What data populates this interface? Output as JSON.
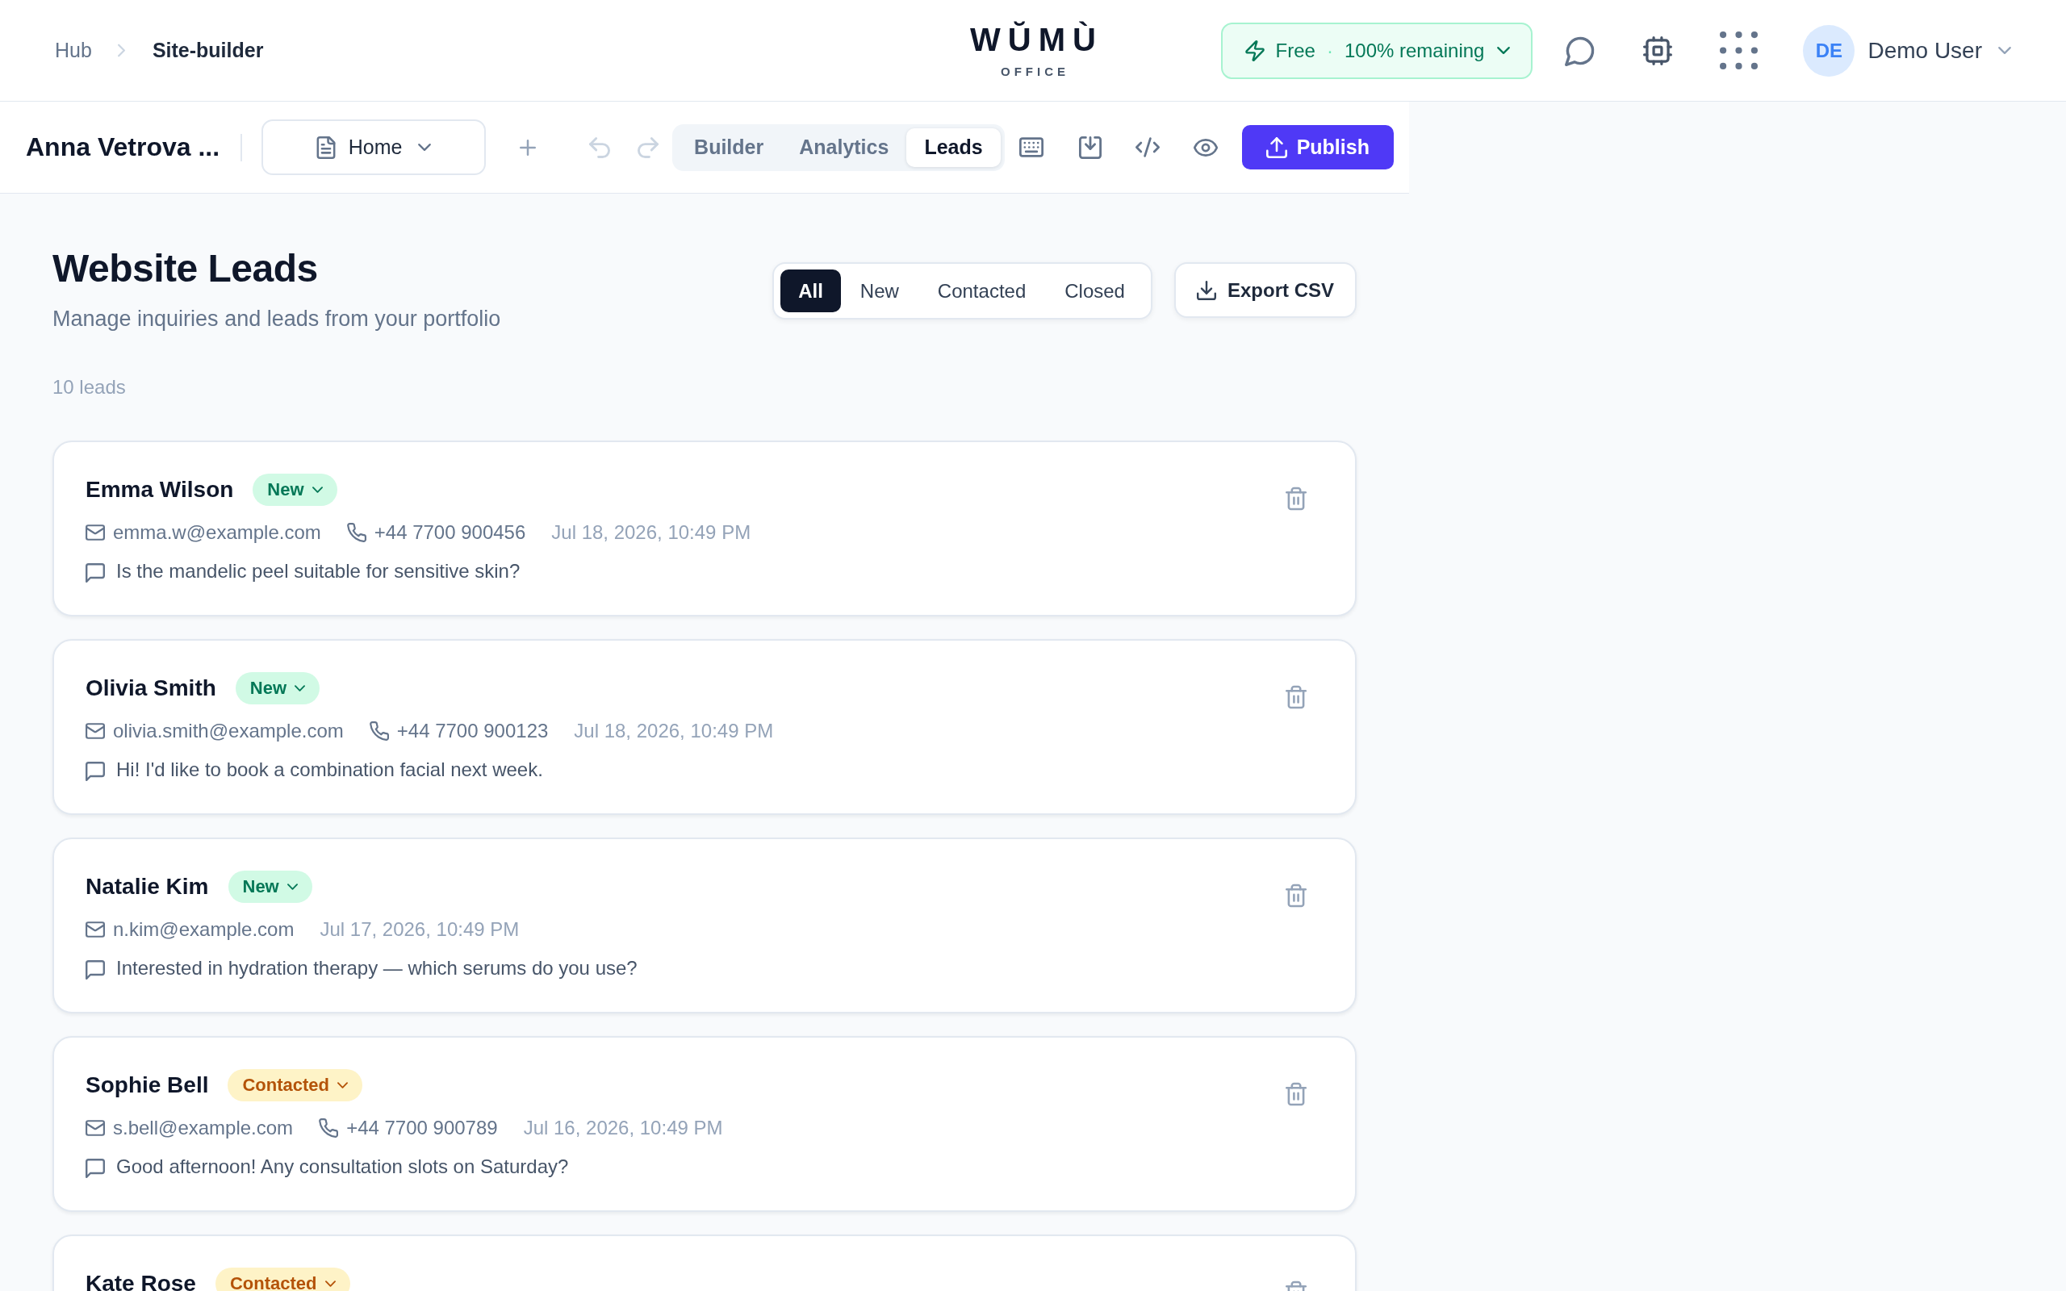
{
  "header": {
    "breadcrumb": [
      {
        "label": "Hub",
        "current": false
      },
      {
        "label": "Site-builder",
        "current": true
      }
    ],
    "logo": {
      "wordmark": "WŬMÙ",
      "tagline": "OFFICE"
    },
    "plan": {
      "name": "Free",
      "separator": "·",
      "quota": "100% remaining"
    },
    "user": {
      "initials": "DE",
      "name": "Demo User"
    }
  },
  "toolbar": {
    "site_name": "Anna Vetrova ...",
    "page_select": {
      "value": "Home"
    },
    "modes": [
      {
        "label": "Builder",
        "selected": false
      },
      {
        "label": "Analytics",
        "selected": false
      },
      {
        "label": "Leads",
        "selected": true
      }
    ],
    "publish": "Publish"
  },
  "leads": {
    "title": "Website Leads",
    "subtitle": "Manage inquiries and leads from your portfolio",
    "filters": [
      {
        "label": "All",
        "selected": true
      },
      {
        "label": "New",
        "selected": false
      },
      {
        "label": "Contacted",
        "selected": false
      },
      {
        "label": "Closed",
        "selected": false
      }
    ],
    "export": "Export CSV",
    "count": "10 leads",
    "items": [
      {
        "name": "Emma Wilson",
        "status": {
          "label": "New",
          "kind": "new"
        },
        "email": "emma.w@example.com",
        "phone": "+44 7700 900456",
        "date": "Jul 18, 2026, 10:49 PM",
        "message": "Is the mandelic peel suitable for sensitive skin?"
      },
      {
        "name": "Olivia Smith",
        "status": {
          "label": "New",
          "kind": "new"
        },
        "email": "olivia.smith@example.com",
        "phone": "+44 7700 900123",
        "date": "Jul 18, 2026, 10:49 PM",
        "message": "Hi! I'd like to book a combination facial next week."
      },
      {
        "name": "Natalie Kim",
        "status": {
          "label": "New",
          "kind": "new"
        },
        "email": "n.kim@example.com",
        "date": "Jul 17, 2026, 10:49 PM",
        "message": "Interested in hydration therapy — which serums do you use?"
      },
      {
        "name": "Sophie Bell",
        "status": {
          "label": "Contacted",
          "kind": "contacted"
        },
        "email": "s.bell@example.com",
        "phone": "+44 7700 900789",
        "date": "Jul 16, 2026, 10:49 PM",
        "message": "Good afternoon! Any consultation slots on Saturday?"
      },
      {
        "name": "Kate Rose",
        "status": {
          "label": "Contacted",
          "kind": "contacted"
        }
      }
    ]
  }
}
